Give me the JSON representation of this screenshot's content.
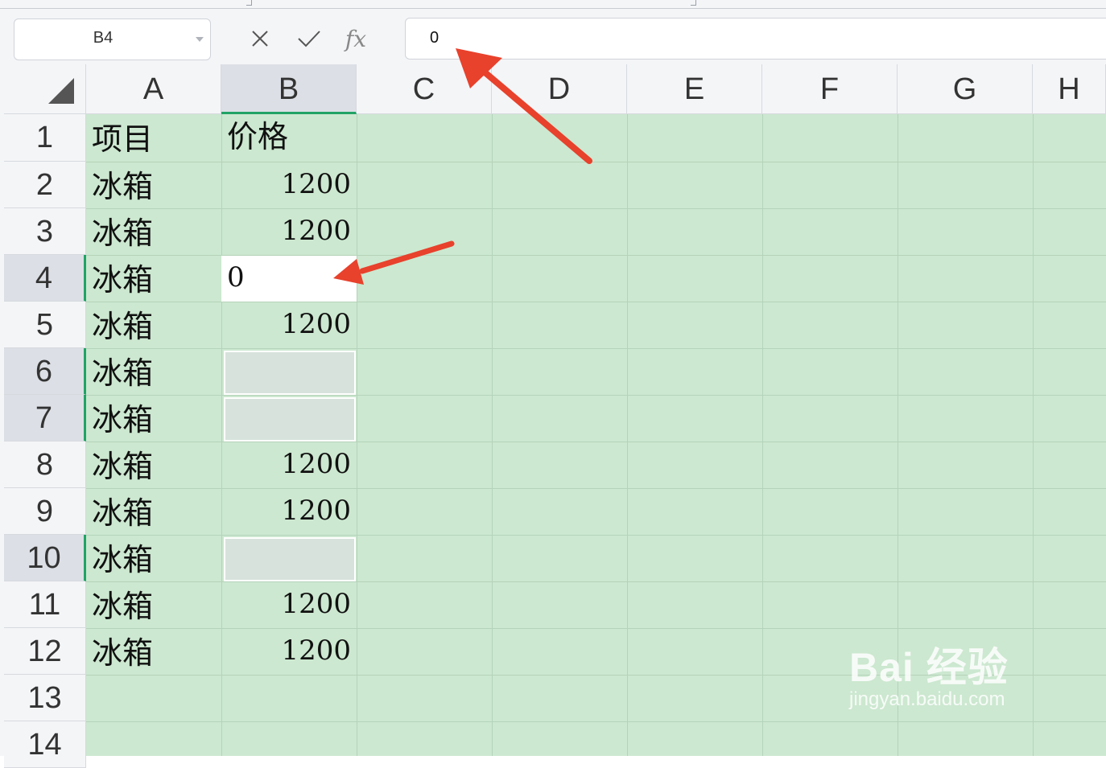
{
  "name_box": {
    "value": "B4"
  },
  "formula_bar": {
    "value": "0",
    "fx_label": "fx"
  },
  "columns": [
    "A",
    "B",
    "C",
    "D",
    "E",
    "F",
    "G",
    "H"
  ],
  "selected_column": "B",
  "rows": [
    {
      "n": "1",
      "a": "项目",
      "b": "价格"
    },
    {
      "n": "2",
      "a": "冰箱",
      "b": "1200"
    },
    {
      "n": "3",
      "a": "冰箱",
      "b": "1200"
    },
    {
      "n": "4",
      "a": "冰箱",
      "b": "0"
    },
    {
      "n": "5",
      "a": "冰箱",
      "b": "1200"
    },
    {
      "n": "6",
      "a": "冰箱",
      "b": ""
    },
    {
      "n": "7",
      "a": "冰箱",
      "b": ""
    },
    {
      "n": "8",
      "a": "冰箱",
      "b": "1200"
    },
    {
      "n": "9",
      "a": "冰箱",
      "b": "1200"
    },
    {
      "n": "10",
      "a": "冰箱",
      "b": ""
    },
    {
      "n": "11",
      "a": "冰箱",
      "b": "1200"
    },
    {
      "n": "12",
      "a": "冰箱",
      "b": "1200"
    },
    {
      "n": "13",
      "a": "",
      "b": ""
    },
    {
      "n": "14",
      "a": "",
      "b": ""
    }
  ],
  "selected_rows": [
    "4",
    "6",
    "7",
    "10"
  ],
  "watermark": {
    "brand": "Bai 经验",
    "url": "jingyan.baidu.com"
  },
  "colors": {
    "grid_fill": "#cce8d0",
    "accent": "#21a366",
    "annotation_arrow": "#e8412c"
  }
}
